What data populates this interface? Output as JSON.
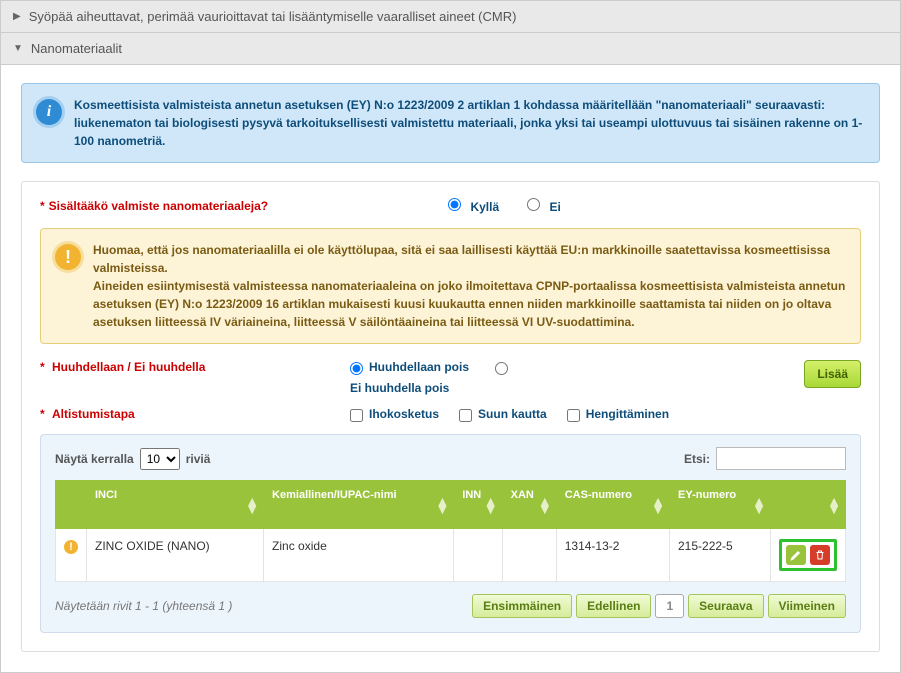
{
  "accordion": {
    "cmr_title": "Syöpää aiheuttavat, perimää vaurioittavat tai lisääntymiselle vaaralliset aineet (CMR)",
    "nano_title": "Nanomateriaalit"
  },
  "info": {
    "text1": "Kosmeettisista valmisteista annetun asetuksen (EY) N:o 1223/2009 2 artiklan 1 kohdassa määritellään \"nanomateriaali\" seuraavasti:",
    "text2": "liukenematon tai biologisesti pysyvä tarkoituksellisesti valmistettu materiaali, jonka yksi tai useampi ulottuvuus tai sisäinen rakenne on 1-100 nanometriä."
  },
  "form": {
    "q_contain": "Sisältääkö valmiste nanomateriaaleja?",
    "yes": "Kyllä",
    "no": "Ei",
    "rinse_label": "Huuhdellaan / Ei huuhdella",
    "rinse_off": "Huuhdellaan pois",
    "no_rinse": "Ei huuhdella pois",
    "exposure_label": "Altistumistapa",
    "dermal": "Ihokosketus",
    "oral": "Suun kautta",
    "inhalation": "Hengittäminen",
    "add_btn": "Lisää"
  },
  "warn": {
    "p1": "Huomaa, että jos nanomateriaalilla ei ole käyttölupaa, sitä ei saa laillisesti käyttää EU:n markkinoille saatettavissa kosmeettisissa valmisteissa.",
    "p2": "Aineiden esiintymisestä valmisteessa nanomateriaaleina on joko ilmoitettava CPNP-portaalissa kosmeettisista valmisteista annetun asetuksen (EY) N:o 1223/2009 16 artiklan mukaisesti kuusi kuukautta ennen niiden markkinoille saattamista tai niiden on jo oltava asetuksen liitteessä IV väriaineina, liitteessä V säilöntäaineina tai liitteessä VI UV-suodattimina."
  },
  "table": {
    "show_prefix": "Näytä kerralla",
    "show_suffix": "riviä",
    "page_size": "10",
    "search_label": "Etsi:",
    "headers": {
      "inci": "INCI",
      "chem": "Kemiallinen/IUPAC-nimi",
      "inn": "INN",
      "xan": "XAN",
      "cas": "CAS-numero",
      "ey": "EY-numero"
    },
    "rows": [
      {
        "inci": "ZINC OXIDE (NANO)",
        "chem": "Zinc oxide",
        "inn": "",
        "xan": "",
        "cas": "1314-13-2",
        "ey": "215-222-5"
      }
    ],
    "footer_info": "Näytetään rivit 1 - 1 (yhteensä 1 )",
    "pager": {
      "first": "Ensimmäinen",
      "prev": "Edellinen",
      "page": "1",
      "next": "Seuraava",
      "last": "Viimeinen"
    }
  }
}
